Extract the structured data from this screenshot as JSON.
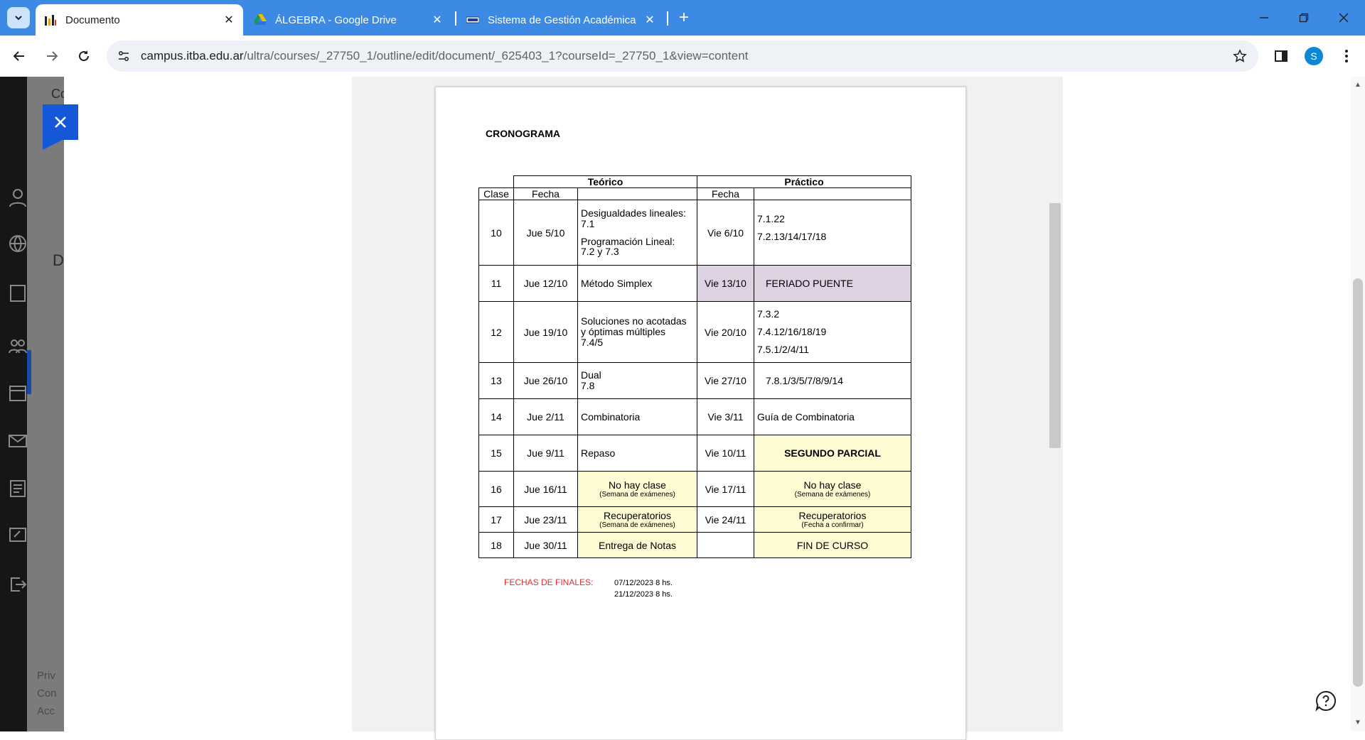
{
  "browser": {
    "tabs": [
      {
        "title": "Documento",
        "favicon": "bar-chart-favicon",
        "active": true
      },
      {
        "title": "ÁLGEBRA - Google Drive",
        "favicon": "google-drive-icon",
        "active": false
      },
      {
        "title": "Sistema de Gestión Académica",
        "favicon": "sga-icon",
        "active": false
      }
    ],
    "url_host": "campus.itba.edu.ar",
    "url_path": "/ultra/courses/_27750_1/outline/edit/document/_625403_1?courseId=_27750_1&view=content",
    "profile_initial": "S"
  },
  "left_panel": {
    "fragments": [
      "Co",
      "D"
    ],
    "footer": [
      "Priv",
      "Con",
      "Acc"
    ]
  },
  "doc": {
    "heading": "CRONOGRAMA",
    "group_headers": {
      "teorico": "Teórico",
      "practico": "Práctico"
    },
    "col_headers": {
      "clase": "Clase",
      "fecha_t": "Fecha",
      "fecha_p": "Fecha"
    },
    "rows": [
      {
        "clase": "10",
        "fecha_t": "Jue  5/10",
        "teorico": [
          "Desigualdades lineales:",
          "7.1",
          "Programación Lineal:",
          "7.2 y 7.3"
        ],
        "fecha_p": "Vie 6/10",
        "practico": [
          "7.1.22",
          "7.2.13/14/17/18"
        ]
      },
      {
        "clase": "11",
        "fecha_t": "Jue 12/10",
        "teorico": [
          "Método Simplex"
        ],
        "fecha_p": "Vie 13/10",
        "practico": [
          "FERIADO PUENTE"
        ]
      },
      {
        "clase": "12",
        "fecha_t": "Jue  19/10",
        "teorico": [
          "Soluciones no acotadas",
          "y óptimas múltiples",
          "7.4/5"
        ],
        "fecha_p": "Vie 20/10",
        "practico": [
          "7.3.2",
          "7.4.12/16/18/19",
          "7.5.1/2/4/11"
        ]
      },
      {
        "clase": "13",
        "fecha_t": "Jue 26/10",
        "teorico": [
          "Dual",
          "7.8"
        ],
        "fecha_p": "Vie 27/10",
        "practico": [
          "7.8.1/3/5/7/8/9/14"
        ]
      },
      {
        "clase": "14",
        "fecha_t": "Jue  2/11",
        "teorico": [
          "Combinatoria"
        ],
        "fecha_p": "Vie 3/11",
        "practico": [
          "Guía de  Combinatoria"
        ]
      },
      {
        "clase": "15",
        "fecha_t": "Jue  9/11",
        "teorico": [
          "Repaso"
        ],
        "fecha_p": "Vie 10/11",
        "practico": [
          "SEGUNDO PARCIAL"
        ]
      },
      {
        "clase": "16",
        "fecha_t": "Jue  16/11",
        "teorico": [
          "No hay clase",
          "(Semana de exámenes)"
        ],
        "fecha_p": "Vie 17/11",
        "practico": [
          "No hay clase",
          "(Semana de exámenes)"
        ]
      },
      {
        "clase": "17",
        "fecha_t": "Jue  23/11",
        "teorico": [
          "Recuperatorios",
          "(Semana de exámenes)"
        ],
        "fecha_p": "Vie 24/11",
        "practico": [
          "Recuperatorios",
          "(Fecha a confirmar)"
        ]
      },
      {
        "clase": "18",
        "fecha_t": "Jue 30/11",
        "teorico": [
          "Entrega de Notas"
        ],
        "fecha_p": "",
        "practico": [
          "FIN DE CURSO"
        ]
      }
    ],
    "finales_label": "FECHAS DE FINALES:",
    "finales_dates": [
      "07/12/2023  8 hs.",
      "21/12/2023  8 hs."
    ]
  },
  "colors": {
    "tabstrip": "#3c8ae3",
    "highlight_yellow": "#fdfbd2",
    "highlight_purple": "#ddd2e2",
    "finales_label": "#e03030",
    "close_button": "#1457d8"
  }
}
